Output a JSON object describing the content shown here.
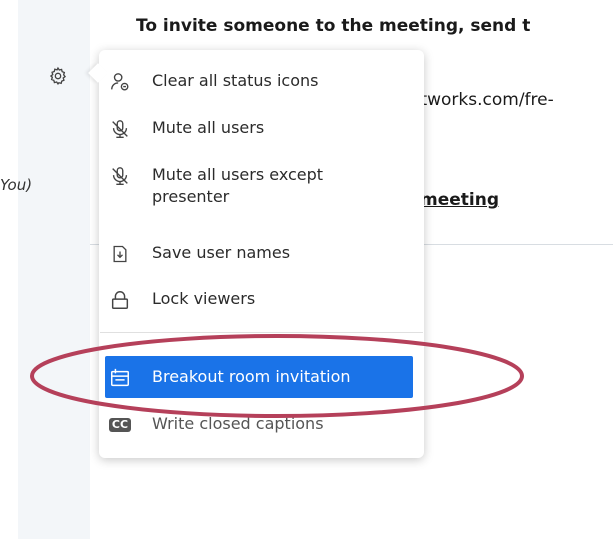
{
  "user_list": {
    "you_label": "You)"
  },
  "chat": {
    "welcome_text": "To invite someone to the meeting, send t",
    "link_partial": "etworks.com/fre-",
    "meeting_link": "meeting"
  },
  "menu": {
    "items": [
      {
        "label": "Clear all status icons",
        "icon": "clear-status-icon"
      },
      {
        "label": "Mute all users",
        "icon": "mic-off-icon"
      },
      {
        "label": "Mute all users except\npresenter",
        "icon": "mic-off-icon"
      },
      {
        "label": "Save user names",
        "icon": "download-file-icon"
      },
      {
        "label": "Lock viewers",
        "icon": "lock-icon"
      },
      {
        "label": "Breakout room invitation",
        "icon": "breakout-room-icon"
      },
      {
        "label": "Write closed captions",
        "icon": "closed-captions-icon",
        "badge": "CC"
      }
    ]
  },
  "colors": {
    "highlight": "#1a73e8",
    "annotation": "#b5405a"
  }
}
